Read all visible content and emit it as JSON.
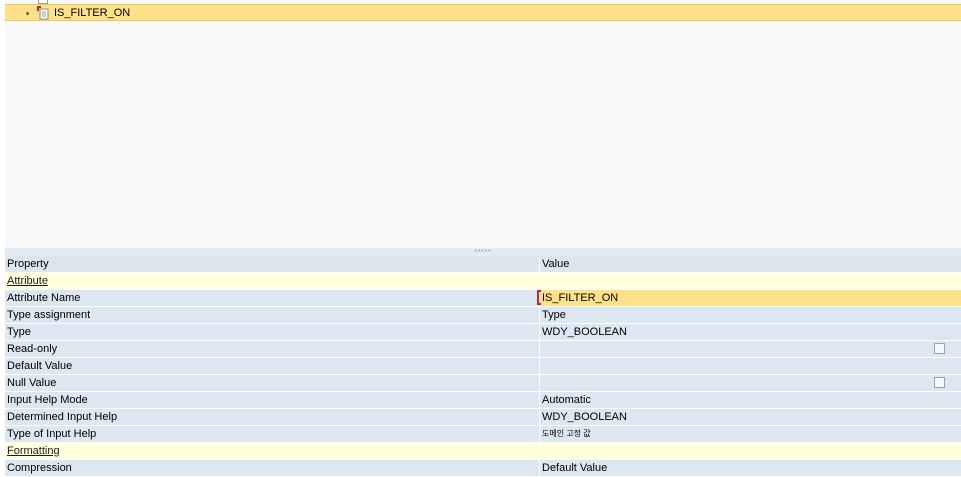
{
  "tree": {
    "selected_node": "IS_FILTER_ON"
  },
  "table": {
    "headers": {
      "property": "Property",
      "value": "Value"
    },
    "rows": [
      {
        "kind": "section",
        "property": "Attribute",
        "value": ""
      },
      {
        "kind": "data",
        "property": "Attribute Name",
        "value": "IS_FILTER_ON",
        "active": true
      },
      {
        "kind": "data",
        "property": "Type assignment",
        "value": "Type"
      },
      {
        "kind": "data",
        "property": "Type",
        "value": "WDY_BOOLEAN"
      },
      {
        "kind": "data",
        "property": "Read-only",
        "value": "",
        "checkbox": true,
        "checked": false
      },
      {
        "kind": "data",
        "property": "Default Value",
        "value": ""
      },
      {
        "kind": "data",
        "property": "Null Value",
        "value": "",
        "checkbox": true,
        "checked": false
      },
      {
        "kind": "data",
        "property": "Input Help Mode",
        "value": "Automatic"
      },
      {
        "kind": "data",
        "property": "Determined Input Help",
        "value": "WDY_BOOLEAN"
      },
      {
        "kind": "data",
        "property": "Type of Input Help",
        "value": "도메인 고정 값",
        "small": true
      },
      {
        "kind": "section",
        "property": "Formatting",
        "value": ""
      },
      {
        "kind": "data",
        "property": "Compression",
        "value": "Default Value"
      }
    ]
  },
  "icons": {
    "tree_bullet": "bullet-icon",
    "attribute_node": "attribute-node-icon",
    "splitter_grip": "splitter-grip-icon"
  },
  "colors": {
    "selection": "#ffe18a",
    "section_row": "#ffffdc",
    "data_row": "#dce7f1",
    "header_row": "#dde6ee",
    "edit_marker": "#c62828"
  }
}
